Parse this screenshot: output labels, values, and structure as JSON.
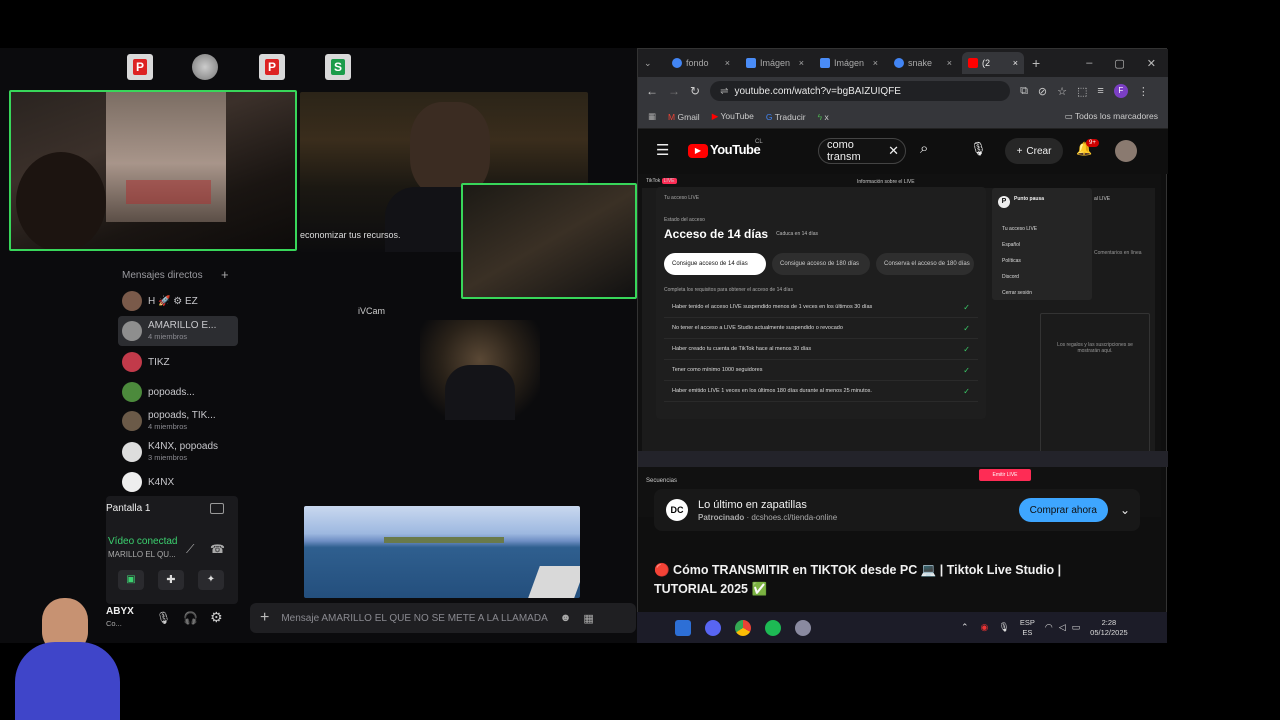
{
  "left": {
    "dm_header": "Mensajes directos",
    "dm_add": "+",
    "dms": [
      {
        "name": "H 🚀 ⚙ EZ",
        "sub": ""
      },
      {
        "name": "AMARILLO E...",
        "sub": "4 miembros"
      },
      {
        "name": "TIKZ",
        "sub": ""
      },
      {
        "name": "popoads...",
        "sub": ""
      },
      {
        "name": "popoads, TIK...",
        "sub": "4 miembros"
      },
      {
        "name": "K4NX, popoads",
        "sub": "3 miembros"
      },
      {
        "name": "K4NX",
        "sub": ""
      }
    ],
    "overlay_text": "economizar tus recursos.",
    "ivcam": "iVCam",
    "screen_label": "Pantalla 1",
    "voice_status": "Vídeo conectad",
    "voice_channel": "MARILLO EL QU...",
    "user_name": "ABYX",
    "user_status": "Co...",
    "chat_placeholder": "Mensaje AMARILLO EL QUE NO SE METE A LA LLAMADA"
  },
  "browser": {
    "tabs": [
      {
        "label": "fondo",
        "icon": "google-icon",
        "color": "#4285f4"
      },
      {
        "label": "Imágen",
        "icon": "docs-icon",
        "color": "#4a8cf7"
      },
      {
        "label": "Imágen",
        "icon": "docs-icon",
        "color": "#4a8cf7"
      },
      {
        "label": "snake",
        "icon": "google-icon",
        "color": "#4285f4"
      },
      {
        "label": "(2",
        "icon": "youtube-icon",
        "color": "#ff0000"
      }
    ],
    "new_tab": "+",
    "url": "youtube.com/watch?v=bgBAIZUIQFE",
    "bookmarks": [
      "Gmail",
      "YouTube",
      "Traducir",
      "x"
    ],
    "all_bookmarks": "Todos los marcadores",
    "yt_logo": "YouTube",
    "yt_region": "CL",
    "search_value": "como transm",
    "create_label": "Crear",
    "notif_count": "9+",
    "video": {
      "modal_title_small": "Tu acceso LIVE",
      "status_label": "Estado del acceso",
      "access_title": "Acceso de 14 días",
      "expires": "Caduca en 14 días",
      "options": [
        "Consigue acceso de 14 días",
        "Consigue acceso de 180 días",
        "Conserva el acceso de 180 días"
      ],
      "req_intro": "Completa los requisitos para obtener el acceso de 14 días",
      "requirements": [
        "Haber tenido el acceso LIVE suspendido menos de 1 veces en los últimos 30 días",
        "No tener el acceso a LIVE Studio actualmente suspendido o revocado",
        "Haber creado tu cuenta de TikTok hace al menos 30 días",
        "Tener como mínimo 1000 seguidores",
        "Haber emitido LIVE 1 veces en los últimos 180 días durante al menos 25 minutos."
      ],
      "menu_name": "Punto pausa",
      "menu_items": [
        "Tu acceso LIVE",
        "Español",
        "Políticas",
        "Discord",
        "Cerrar sesión"
      ],
      "panel_text": "Los regalos y las suscripciones se mostrarán aquí.",
      "live_btn": "Emitir LIVE",
      "secuencias": "Secuencias",
      "app_name": "TikTok",
      "info_title": "Información sobre el LIVE",
      "live_label": "al LIVE",
      "comment_text": "Comentarios en línea"
    },
    "ad_title": "Lo último en zapatillas",
    "ad_sponsored": "Patrocinado",
    "ad_url": "dcshoes.cl/tienda-online",
    "ad_button": "Comprar ahora",
    "video_title": "🔴 Cómo TRANSMITIR en TIKTOK desde PC 💻 | Tiktok Live Studio | TUTORIAL 2025 ✅"
  },
  "taskbar": {
    "lang": "ESP",
    "lang2": "ES",
    "time": "2:28",
    "date": "05/12/2025"
  },
  "colors": {
    "green_border": "#38d65a",
    "yt_red": "#ff0000",
    "ad_button": "#3ea6ff",
    "live_red": "#fe2c55"
  }
}
